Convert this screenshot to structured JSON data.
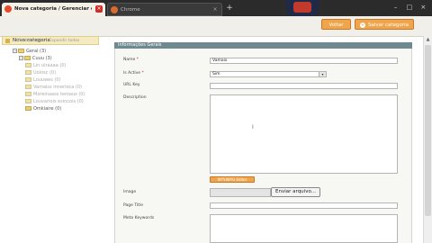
{
  "browser": {
    "tabs": [
      {
        "label": "Nova categoria / Gerenciar categ",
        "close": "×"
      },
      {
        "label": "Chrome",
        "close": "×"
      }
    ],
    "new_tab": "+",
    "window_controls": [
      "–",
      "□",
      "×"
    ]
  },
  "toolbar": {
    "back_label": "Voltar",
    "save_label": "Salvar categoria",
    "save_icon": "+"
  },
  "sidebar": {
    "new_category_label": "Nova categoria",
    "links": [
      "Fechar todos",
      "Expandir todos"
    ],
    "tree": [
      {
        "label": "Geral (3)",
        "level": 0,
        "expander": "−"
      },
      {
        "label": "Cuuu (3)",
        "level": 1,
        "expander": "−"
      },
      {
        "label": "Lin uiraaaa (0)",
        "level": 2
      },
      {
        "label": "Uoiosc (0)",
        "level": 2
      },
      {
        "label": "Louuwes (0)",
        "level": 2
      },
      {
        "label": "Vamaiss innerioca (0)",
        "level": 2
      },
      {
        "label": "Moreinaass teroaus (0)",
        "level": 2
      },
      {
        "label": "Louvariois esincois (0)",
        "level": 2
      },
      {
        "label": "Omkiaire (0)",
        "level": 1
      }
    ]
  },
  "form": {
    "section_title": "Informações Gerais",
    "fields": {
      "name_label": "Name",
      "name_value": "Vamais",
      "active_label": "Is Active",
      "active_value": "Sim",
      "url_label": "URL Key",
      "url_value": "",
      "description_label": "Description",
      "wysiwyg_label": "WYSIWYG Editor",
      "image_label": "Image",
      "file_button_label": "Enviar arquivo...",
      "page_title_label": "Page Title",
      "page_title_value": "",
      "meta_keywords_label": "Meta Keywords"
    },
    "required_mark": "*"
  }
}
